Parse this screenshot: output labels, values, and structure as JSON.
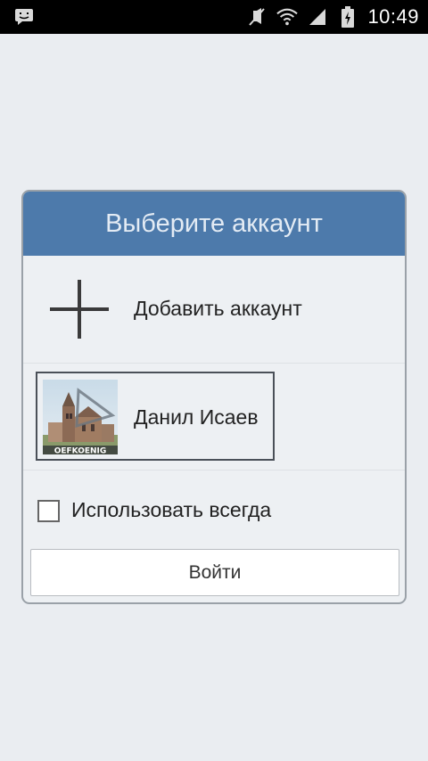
{
  "status_bar": {
    "time": "10:49",
    "icons": [
      "messenger-notification-icon",
      "mute-icon",
      "wifi-icon",
      "signal-icon",
      "battery-charging-icon"
    ]
  },
  "dialog": {
    "title": "Выберите аккаунт",
    "add_account_label": "Добавить аккаунт",
    "account": {
      "name": "Данил Исаев",
      "avatar_caption": "OEFKOENIG"
    },
    "always_use_label": "Использовать всегда",
    "always_use_checked": false,
    "login_button_label": "Войти"
  },
  "colors": {
    "header": "#4d7aab",
    "background": "#eaedf1"
  }
}
